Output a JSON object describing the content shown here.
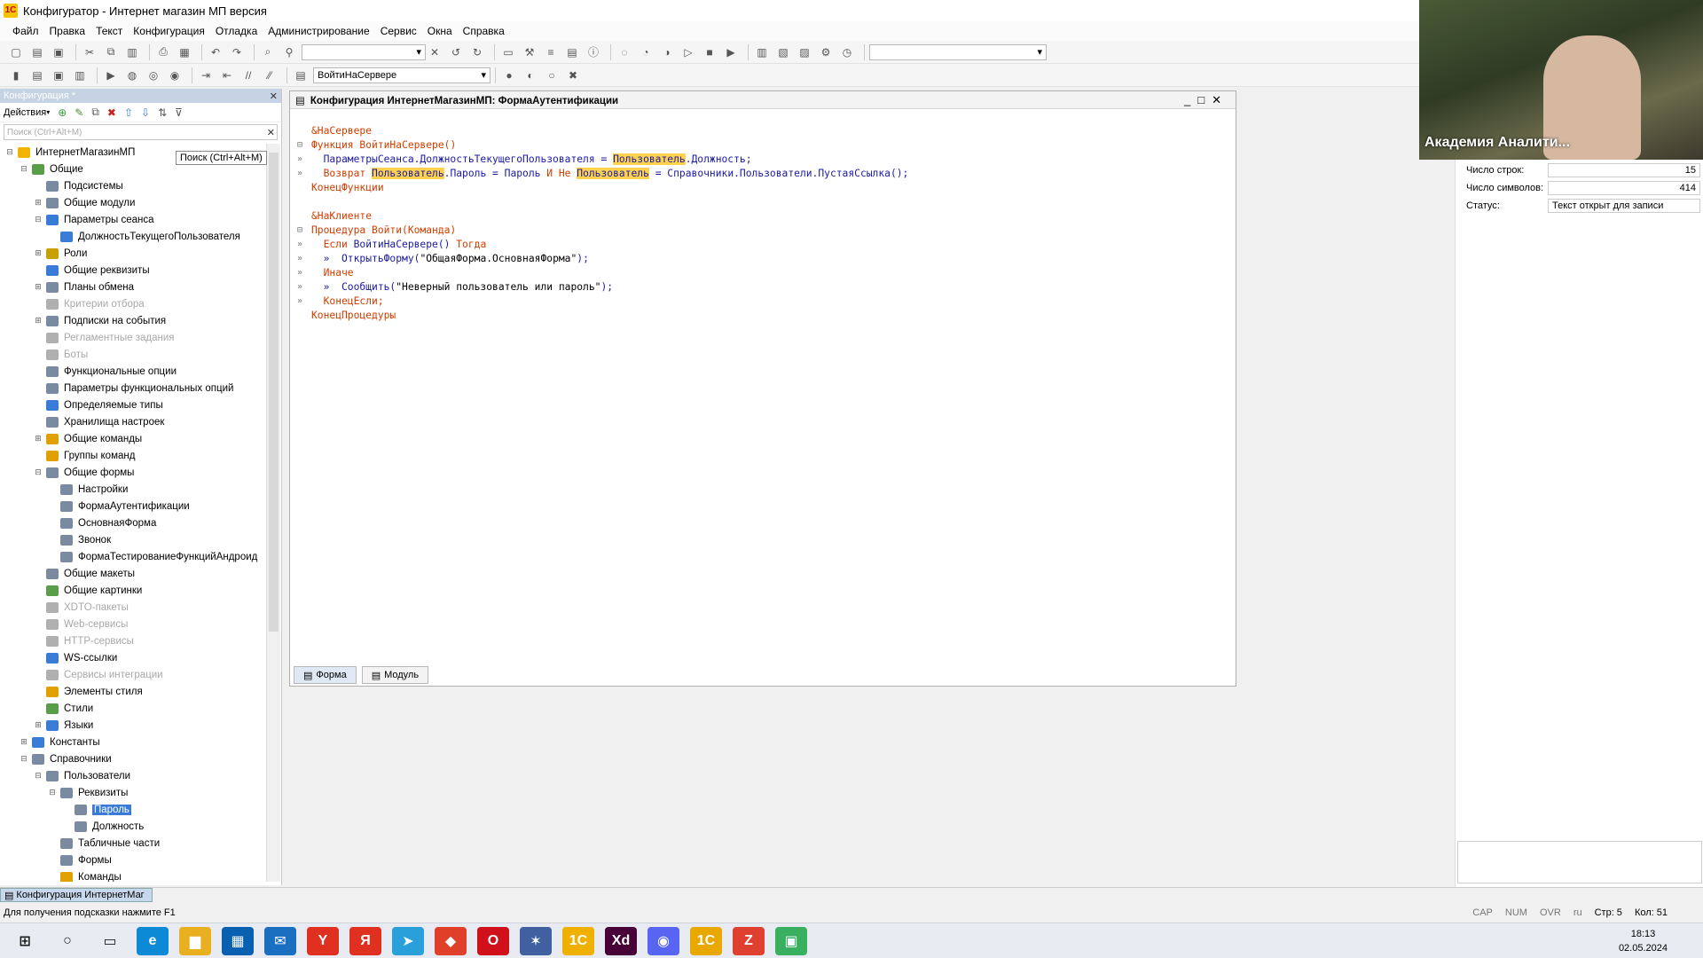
{
  "window": {
    "title": "Конфигуратор - Интернет магазин МП версия"
  },
  "menu": [
    "Файл",
    "Правка",
    "Текст",
    "Конфигурация",
    "Отладка",
    "Администрирование",
    "Сервис",
    "Окна",
    "Справка"
  ],
  "toolbar2": {
    "combo_value": "ВойтиНаСервере"
  },
  "left_panel": {
    "title": "Конфигурация *",
    "actions_label": "Действия",
    "search_placeholder": "Поиск (Ctrl+Alt+M)",
    "tooltip": "Поиск (Ctrl+Alt+M)",
    "tree": [
      {
        "label": "ИнтернетМагазинМП",
        "level": 0,
        "exp": "⊟",
        "color": "#f2b400"
      },
      {
        "label": "Общие",
        "level": 1,
        "exp": "⊟",
        "color": "#5a9e4a"
      },
      {
        "label": "Подсистемы",
        "level": 2,
        "exp": "",
        "color": "#7a8aa0"
      },
      {
        "label": "Общие модули",
        "level": 2,
        "exp": "⊞",
        "color": "#7a8aa0"
      },
      {
        "label": "Параметры сеанса",
        "level": 2,
        "exp": "⊟",
        "color": "#3a7bd5"
      },
      {
        "label": "ДолжностьТекущегоПользователя",
        "level": 3,
        "exp": "",
        "color": "#3a7bd5"
      },
      {
        "label": "Роли",
        "level": 2,
        "exp": "⊞",
        "color": "#c8a000"
      },
      {
        "label": "Общие реквизиты",
        "level": 2,
        "exp": "",
        "color": "#3a7bd5"
      },
      {
        "label": "Планы обмена",
        "level": 2,
        "exp": "⊞",
        "color": "#7a8aa0"
      },
      {
        "label": "Критерии отбора",
        "level": 2,
        "exp": "",
        "color": "#b0b0b0",
        "dim": true
      },
      {
        "label": "Подписки на события",
        "level": 2,
        "exp": "⊞",
        "color": "#7a8aa0"
      },
      {
        "label": "Регламентные задания",
        "level": 2,
        "exp": "",
        "color": "#b0b0b0",
        "dim": true
      },
      {
        "label": "Боты",
        "level": 2,
        "exp": "",
        "color": "#b0b0b0",
        "dim": true
      },
      {
        "label": "Функциональные опции",
        "level": 2,
        "exp": "",
        "color": "#7a8aa0"
      },
      {
        "label": "Параметры функциональных опций",
        "level": 2,
        "exp": "",
        "color": "#7a8aa0"
      },
      {
        "label": "Определяемые типы",
        "level": 2,
        "exp": "",
        "color": "#3a7bd5"
      },
      {
        "label": "Хранилища настроек",
        "level": 2,
        "exp": "",
        "color": "#7a8aa0"
      },
      {
        "label": "Общие команды",
        "level": 2,
        "exp": "⊞",
        "color": "#e0a000"
      },
      {
        "label": "Группы команд",
        "level": 2,
        "exp": "",
        "color": "#e0a000"
      },
      {
        "label": "Общие формы",
        "level": 2,
        "exp": "⊟",
        "color": "#7a8aa0"
      },
      {
        "label": "Настройки",
        "level": 3,
        "exp": "",
        "color": "#7a8aa0"
      },
      {
        "label": "ФормаАутентификации",
        "level": 3,
        "exp": "",
        "color": "#7a8aa0"
      },
      {
        "label": "ОсновнаяФорма",
        "level": 3,
        "exp": "",
        "color": "#7a8aa0"
      },
      {
        "label": "Звонок",
        "level": 3,
        "exp": "",
        "color": "#7a8aa0"
      },
      {
        "label": "ФормаТестированиеФункцийАндроид",
        "level": 3,
        "exp": "",
        "color": "#7a8aa0"
      },
      {
        "label": "Общие макеты",
        "level": 2,
        "exp": "",
        "color": "#7a8aa0"
      },
      {
        "label": "Общие картинки",
        "level": 2,
        "exp": "",
        "color": "#5a9e4a"
      },
      {
        "label": "XDTO-пакеты",
        "level": 2,
        "exp": "",
        "color": "#b0b0b0",
        "dim": true
      },
      {
        "label": "Web-сервисы",
        "level": 2,
        "exp": "",
        "color": "#b0b0b0",
        "dim": true
      },
      {
        "label": "HTTP-сервисы",
        "level": 2,
        "exp": "",
        "color": "#b0b0b0",
        "dim": true
      },
      {
        "label": "WS-ссылки",
        "level": 2,
        "exp": "",
        "color": "#3a7bd5"
      },
      {
        "label": "Сервисы интеграции",
        "level": 2,
        "exp": "",
        "color": "#b0b0b0",
        "dim": true
      },
      {
        "label": "Элементы стиля",
        "level": 2,
        "exp": "",
        "color": "#e0a000"
      },
      {
        "label": "Стили",
        "level": 2,
        "exp": "",
        "color": "#5a9e4a"
      },
      {
        "label": "Языки",
        "level": 2,
        "exp": "⊞",
        "color": "#3a7bd5"
      },
      {
        "label": "Константы",
        "level": 1,
        "exp": "⊞",
        "color": "#3a7bd5"
      },
      {
        "label": "Справочники",
        "level": 1,
        "exp": "⊟",
        "color": "#7a8aa0"
      },
      {
        "label": "Пользователи",
        "level": 2,
        "exp": "⊟",
        "color": "#7a8aa0"
      },
      {
        "label": "Реквизиты",
        "level": 3,
        "exp": "⊟",
        "color": "#7a8aa0"
      },
      {
        "label": "Пароль",
        "level": 4,
        "exp": "",
        "color": "#7a8aa0",
        "sel": true
      },
      {
        "label": "Должность",
        "level": 4,
        "exp": "",
        "color": "#7a8aa0"
      },
      {
        "label": "Табличные части",
        "level": 3,
        "exp": "",
        "color": "#7a8aa0"
      },
      {
        "label": "Формы",
        "level": 3,
        "exp": "",
        "color": "#7a8aa0"
      },
      {
        "label": "Команды",
        "level": 3,
        "exp": "",
        "color": "#e0a000"
      }
    ]
  },
  "editor": {
    "title": "Конфигурация ИнтернетМагазинМП: ФормаАутентификации",
    "tabs": [
      "Форма",
      "Модуль"
    ],
    "lines": [
      [
        {
          "t": "&НаСервере",
          "c": "kw"
        }
      ],
      [
        {
          "g": "⊟"
        },
        {
          "t": "Функция ",
          "c": "kw"
        },
        {
          "t": "ВойтиНаСервере",
          "c": "kw"
        },
        {
          "t": "()",
          "c": "kw"
        }
      ],
      [
        {
          "g": "»"
        },
        {
          "t": "  ПараметрыСеанса.ДолжностьТекущегоПользователя = ",
          "c": "id"
        },
        {
          "t": "Пользователь",
          "c": "id",
          "h": 1
        },
        {
          "t": ".Должность;",
          "c": "id"
        }
      ],
      [
        {
          "g": "»"
        },
        {
          "t": "  Возврат ",
          "c": "kw"
        },
        {
          "t": "Пользователь",
          "c": "id",
          "h": 1
        },
        {
          "t": ".Пароль = Пароль ",
          "c": "id"
        },
        {
          "t": "И Не ",
          "c": "kw"
        },
        {
          "t": "Пользователь",
          "c": "id",
          "h": 1
        },
        {
          "t": " = Справочники.Пользователи.ПустаяСсылка();",
          "c": "id"
        }
      ],
      [
        {
          "t": "КонецФункции",
          "c": "kw"
        }
      ],
      [
        {
          "t": "",
          "c": "st"
        }
      ],
      [
        {
          "t": "&НаКлиенте",
          "c": "kw"
        }
      ],
      [
        {
          "g": "⊟"
        },
        {
          "t": "Процедура ",
          "c": "kw"
        },
        {
          "t": "Войти(Команда)",
          "c": "kw"
        }
      ],
      [
        {
          "g": "»"
        },
        {
          "t": "  Если ",
          "c": "kw"
        },
        {
          "t": "ВойтиНаСервере() ",
          "c": "id"
        },
        {
          "t": "Тогда",
          "c": "kw"
        }
      ],
      [
        {
          "g": "»"
        },
        {
          "t": "  »  ОткрытьФорму(",
          "c": "id"
        },
        {
          "t": "\"ОбщаяФорма.ОсновнаяФорма\"",
          "c": "st"
        },
        {
          "t": ");",
          "c": "id"
        }
      ],
      [
        {
          "g": "»"
        },
        {
          "t": "  Иначе",
          "c": "kw"
        }
      ],
      [
        {
          "g": "»"
        },
        {
          "t": "  »  Сообщить(",
          "c": "id"
        },
        {
          "t": "\"Неверный пользователь или пароль\"",
          "c": "st"
        },
        {
          "t": ");",
          "c": "id"
        }
      ],
      [
        {
          "g": "»"
        },
        {
          "t": "  КонецЕсли;",
          "c": "kw"
        }
      ],
      [
        {
          "t": "КонецПроцедуры",
          "c": "kw"
        }
      ]
    ]
  },
  "properties": {
    "rows": [
      {
        "label": "Число строк:",
        "value": "15"
      },
      {
        "label": "Число символов:",
        "value": "414"
      },
      {
        "label": "Статус:",
        "value": "Текст открыт для записи"
      }
    ]
  },
  "video": {
    "caption": "Академия Аналити..."
  },
  "docbar": {
    "tab": "Конфигурация ИнтернетМаг"
  },
  "status": {
    "hint": "Для получения подсказки нажмите F1",
    "indicators": [
      "CAP",
      "NUM",
      "OVR",
      "ru",
      "Стр: 5",
      "Кол: 51"
    ]
  },
  "taskbar": {
    "time": "18:13",
    "date": "02.05.2024",
    "apps": [
      {
        "name": "windows-start-icon",
        "g": "⊞",
        "c": "#1a1a1a"
      },
      {
        "name": "search-icon",
        "g": "○",
        "c": "#1a1a1a"
      },
      {
        "name": "task-view-icon",
        "g": "▭",
        "c": "#1a1a1a"
      },
      {
        "name": "edge-icon",
        "g": "e",
        "c": "#0c8ad6"
      },
      {
        "name": "explorer-icon",
        "g": "▆",
        "c": "#e8b020"
      },
      {
        "name": "store-icon",
        "g": "▦",
        "c": "#0a60b0"
      },
      {
        "name": "mail-icon",
        "g": "✉",
        "c": "#1a6fc0"
      },
      {
        "name": "yandex-browser-icon",
        "g": "Y",
        "c": "#e03020"
      },
      {
        "name": "yandex-icon",
        "g": "Я",
        "c": "#e03020"
      },
      {
        "name": "telegram-icon",
        "g": "➤",
        "c": "#2aa0da"
      },
      {
        "name": "anydesk-icon",
        "g": "◆",
        "c": "#e0402a"
      },
      {
        "name": "opera-icon",
        "g": "O",
        "c": "#d0101a"
      },
      {
        "name": "tools-icon",
        "g": "✶",
        "c": "#4060a0"
      },
      {
        "name": "onec-icon",
        "g": "1С",
        "c": "#f0b000"
      },
      {
        "name": "xd-icon",
        "g": "Xd",
        "c": "#470137"
      },
      {
        "name": "discord-icon",
        "g": "◉",
        "c": "#5865f2"
      },
      {
        "name": "onec-designer-icon",
        "g": "1С",
        "c": "#e8a800"
      },
      {
        "name": "zoom-icon",
        "g": "Z",
        "c": "#e04030"
      },
      {
        "name": "chat-icon",
        "g": "▣",
        "c": "#38b060"
      }
    ]
  }
}
